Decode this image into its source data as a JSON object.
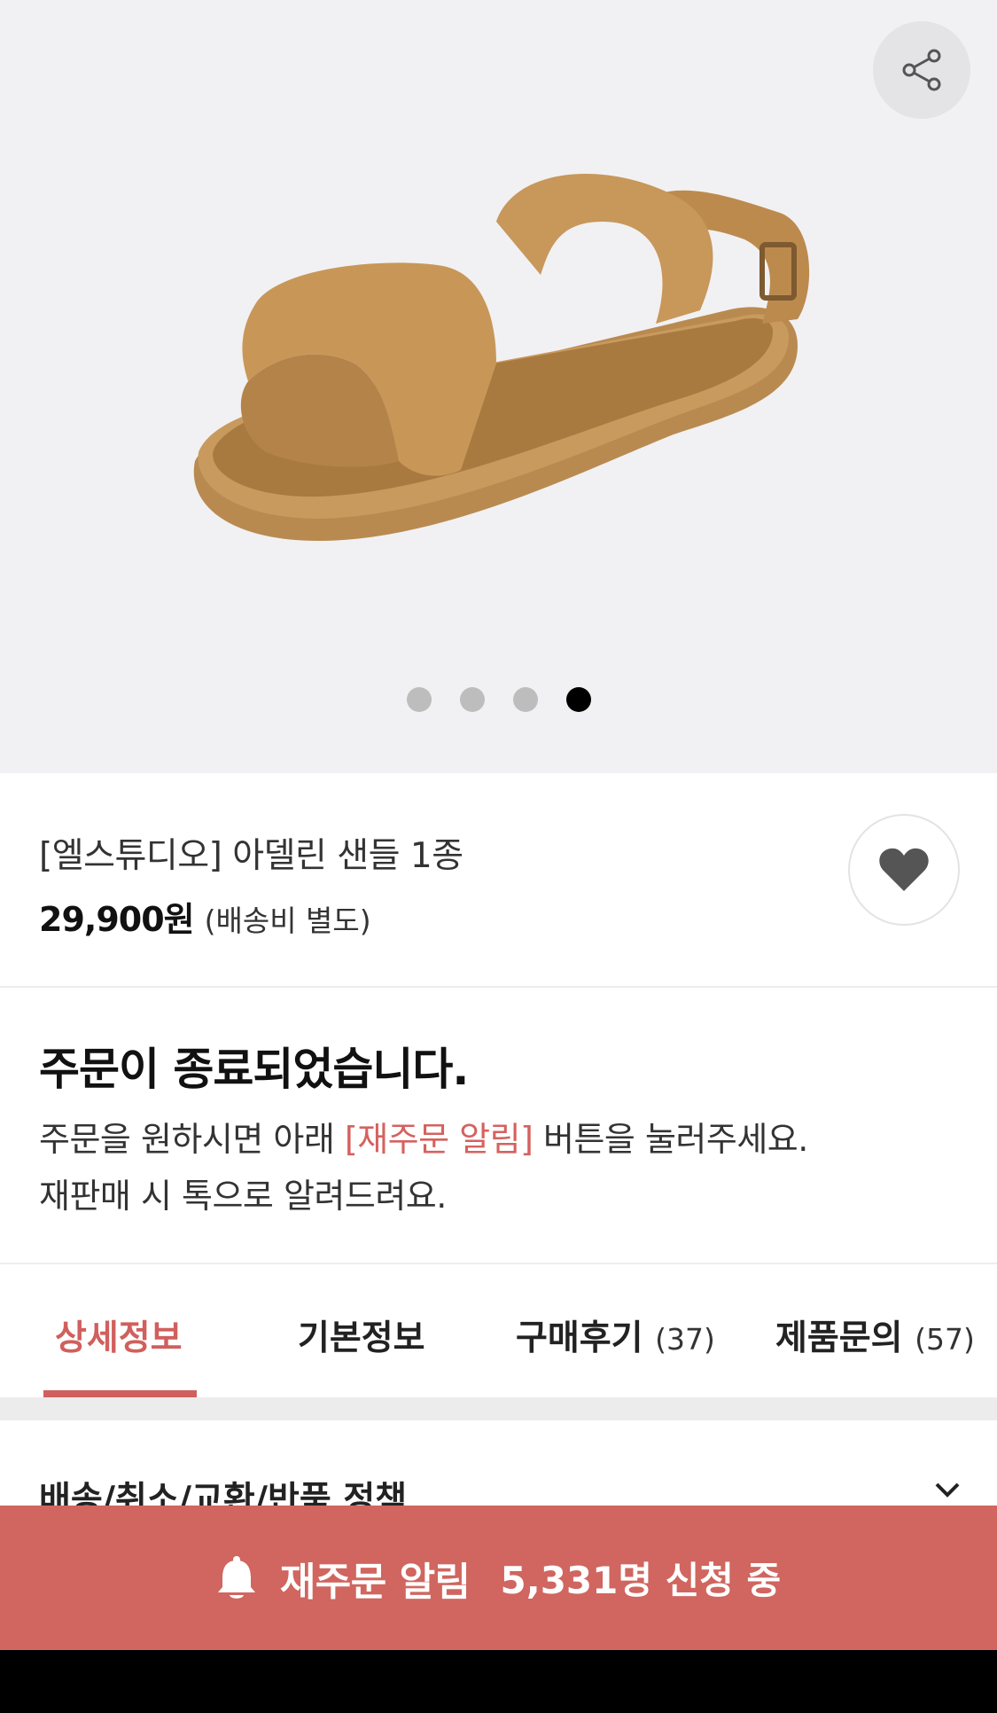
{
  "gallery": {
    "share_icon": "share-icon",
    "slide_count": 4,
    "active_slide": 4
  },
  "product": {
    "title": "[엘스튜디오] 아델린 샌들 1종",
    "price": "29,900원",
    "shipping_note": "(배송비 별도)",
    "favorite_icon": "heart-icon"
  },
  "notice": {
    "heading": "주문이 종료되었습니다.",
    "line1_before": "주문을 원하시면 아래 ",
    "line1_highlight": "[재주문 알림]",
    "line1_after": " 버튼을 눌러주세요.",
    "line2": "재판매 시 톡으로 알려드려요."
  },
  "tabs": [
    {
      "label": "상세정보",
      "count": ""
    },
    {
      "label": "기본정보",
      "count": ""
    },
    {
      "label": "구매후기",
      "count": "(37)"
    },
    {
      "label": "제품문의",
      "count": "(57)"
    }
  ],
  "policy": {
    "label": "배송/취소/교환/반품 정책"
  },
  "cta": {
    "label": "재주문 알림",
    "count_text": "5,331명 신청 중",
    "icon": "bell-icon"
  },
  "colors": {
    "accent": "#d0605d",
    "cta_background": "#d0665f",
    "hero_background": "#f1f1f3"
  }
}
